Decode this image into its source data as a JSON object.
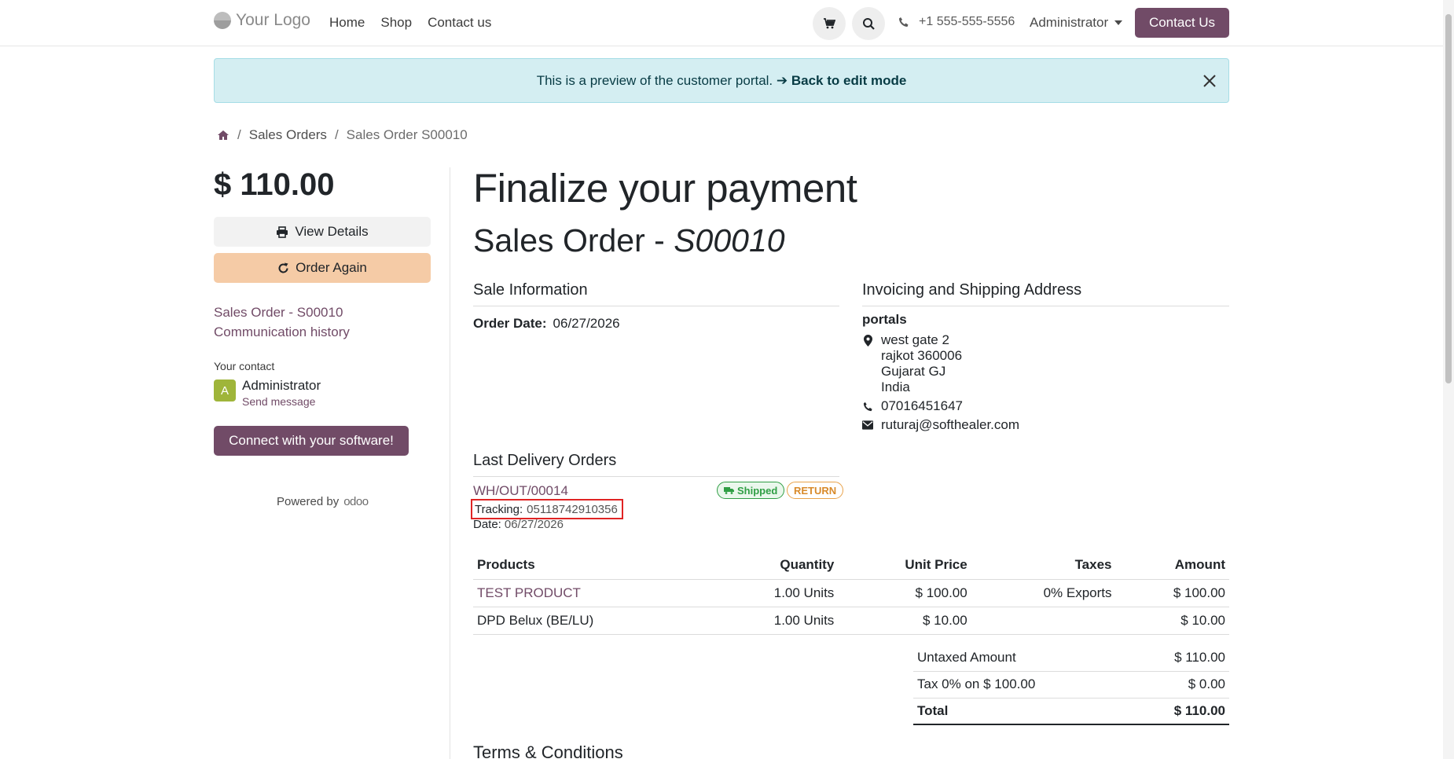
{
  "header": {
    "logo_text": "Your Logo",
    "nav": [
      "Home",
      "Shop",
      "Contact us"
    ],
    "phone": "+1 555-555-5556",
    "user": "Administrator",
    "contact_button": "Contact Us"
  },
  "alert": {
    "text": "This is a preview of the customer portal.",
    "link": "➔ Back to edit mode"
  },
  "breadcrumb": {
    "items": [
      "Sales Orders",
      "Sales Order S00010"
    ]
  },
  "sidebar": {
    "price": "$ 110.00",
    "view_details": "View Details",
    "order_again": "Order Again",
    "links": [
      "Sales Order - S00010",
      "Communication history"
    ],
    "your_contact_label": "Your contact",
    "avatar_letter": "A",
    "contact_name": "Administrator",
    "send_message": "Send message",
    "connect_button": "Connect with your software!",
    "powered_by": "Powered by",
    "powered_brand": "odoo"
  },
  "main": {
    "title": "Finalize your payment",
    "subtitle_prefix": "Sales Order - ",
    "subtitle_ref": "S00010",
    "sale_info_title": "Sale Information",
    "order_date_label": "Order Date:",
    "order_date": "06/27/2026",
    "address_title": "Invoicing and Shipping Address",
    "address": {
      "name": "portals",
      "lines": [
        "west gate 2",
        "rajkot 360006",
        "Gujarat GJ",
        "India"
      ],
      "phone": "07016451647",
      "email": "ruturaj@softhealer.com"
    },
    "delivery_title": "Last Delivery Orders",
    "delivery": {
      "ref": "WH/OUT/00014",
      "status_badge": "Shipped",
      "return_badge": "RETURN",
      "tracking_label": "Tracking:",
      "tracking_value": "05118742910356",
      "date_label": "Date:",
      "date_value": "06/27/2026"
    },
    "table": {
      "headers": [
        "Products",
        "Quantity",
        "Unit Price",
        "Taxes",
        "Amount"
      ],
      "rows": [
        [
          "TEST PRODUCT",
          "1.00 Units",
          "$ 100.00",
          "0% Exports",
          "$ 100.00"
        ],
        [
          "DPD Belux (BE/LU)",
          "1.00 Units",
          "$ 10.00",
          "",
          "$ 10.00"
        ]
      ]
    },
    "totals": [
      [
        "Untaxed Amount",
        "$ 110.00"
      ],
      [
        "Tax 0% on $ 100.00",
        "$ 0.00"
      ],
      [
        "Total",
        "$ 110.00"
      ]
    ],
    "terms_title": "Terms & Conditions"
  },
  "colors": {
    "brand": "#714b67",
    "alert_bg": "#d4eef2",
    "order_again_bg": "#f5cba6",
    "shipped_green": "#2f9e44",
    "return_orange": "#e8a24a",
    "highlight_red": "#e02424"
  }
}
